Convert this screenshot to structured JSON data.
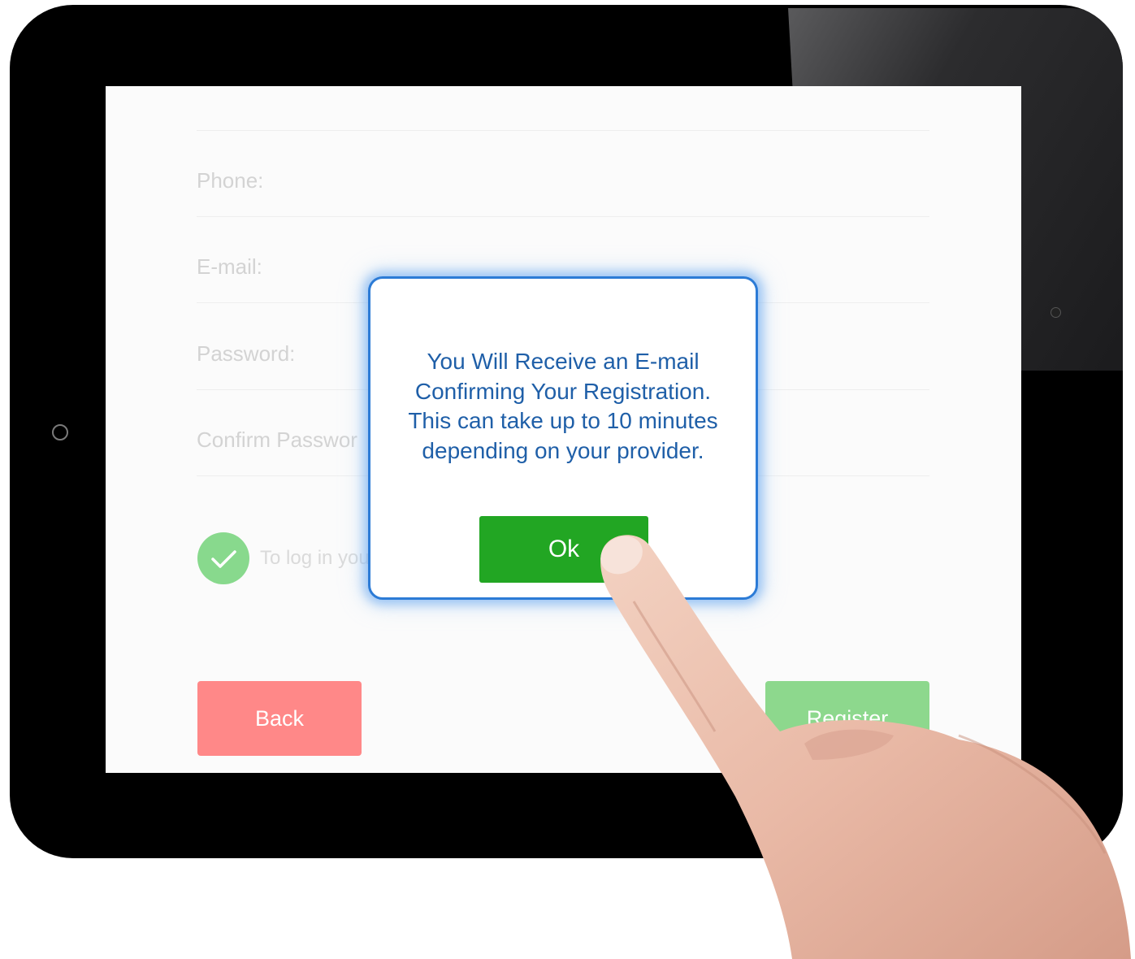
{
  "form": {
    "phone_label": "Phone:",
    "email_label": "E-mail:",
    "password_label": "Password:",
    "confirm_password_label": "Confirm Passwor",
    "checkbox_text": "To log in you",
    "back_label": "Back",
    "register_label": "Register"
  },
  "dialog": {
    "line1": "You Will Receive an E-mail",
    "line2": "Confirming Your Registration.",
    "line3": "This can take up to 10 minutes",
    "line4": "depending on your provider.",
    "ok_label": "Ok"
  },
  "icons": {
    "checkbox": "check-icon",
    "home_button": "home-button-icon",
    "camera": "camera-icon"
  },
  "colors": {
    "dialog_border": "#2c7bd6",
    "dialog_text": "#1f5fa8",
    "ok_button": "#22a623",
    "back_button": "#ff8888",
    "register_button": "#8dd88d",
    "checkbox": "#88d98d"
  }
}
